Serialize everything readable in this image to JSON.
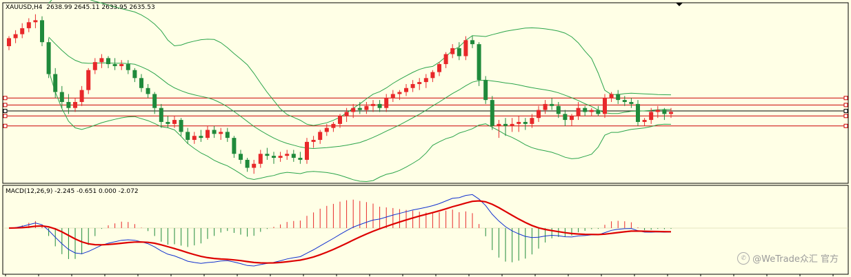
{
  "chart_data": [
    {
      "type": "candlestick",
      "symbol_title": "XAUUSD,H4",
      "ohlc_readout": "2638.99 2645.11 2633.95 2635.53",
      "header_text": "XAUUSD,H4  2638.99 2645.11 2633.95 2635.53",
      "bullish_color": "#e8282a",
      "bearish_color": "#1f8a3b",
      "candles": [
        [
          2652,
          2662,
          2648,
          2660
        ],
        [
          2660,
          2668,
          2655,
          2664
        ],
        [
          2664,
          2675,
          2660,
          2670
        ],
        [
          2670,
          2680,
          2666,
          2676
        ],
        [
          2676,
          2684,
          2670,
          2678
        ],
        [
          2678,
          2682,
          2652,
          2656
        ],
        [
          2656,
          2660,
          2620,
          2624
        ],
        [
          2624,
          2630,
          2600,
          2606
        ],
        [
          2606,
          2612,
          2590,
          2596
        ],
        [
          2596,
          2604,
          2584,
          2590
        ],
        [
          2590,
          2600,
          2586,
          2596
        ],
        [
          2596,
          2612,
          2592,
          2608
        ],
        [
          2608,
          2630,
          2604,
          2628
        ],
        [
          2628,
          2640,
          2624,
          2636
        ],
        [
          2636,
          2644,
          2630,
          2640
        ],
        [
          2640,
          2642,
          2630,
          2634
        ],
        [
          2634,
          2640,
          2628,
          2632
        ],
        [
          2632,
          2638,
          2628,
          2634
        ],
        [
          2634,
          2638,
          2624,
          2628
        ],
        [
          2628,
          2630,
          2616,
          2620
        ],
        [
          2620,
          2624,
          2606,
          2610
        ],
        [
          2610,
          2614,
          2600,
          2604
        ],
        [
          2604,
          2606,
          2584,
          2590
        ],
        [
          2590,
          2594,
          2570,
          2576
        ],
        [
          2576,
          2582,
          2570,
          2574
        ],
        [
          2574,
          2582,
          2570,
          2578
        ],
        [
          2578,
          2580,
          2562,
          2566
        ],
        [
          2566,
          2570,
          2554,
          2558
        ],
        [
          2558,
          2566,
          2554,
          2562
        ],
        [
          2562,
          2568,
          2556,
          2560
        ],
        [
          2560,
          2572,
          2558,
          2568
        ],
        [
          2568,
          2572,
          2560,
          2564
        ],
        [
          2564,
          2570,
          2558,
          2566
        ],
        [
          2566,
          2570,
          2556,
          2560
        ],
        [
          2560,
          2562,
          2540,
          2544
        ],
        [
          2544,
          2548,
          2534,
          2538
        ],
        [
          2538,
          2540,
          2526,
          2530
        ],
        [
          2530,
          2538,
          2524,
          2534
        ],
        [
          2534,
          2548,
          2530,
          2544
        ],
        [
          2544,
          2550,
          2538,
          2542
        ],
        [
          2542,
          2546,
          2534,
          2540
        ],
        [
          2540,
          2546,
          2536,
          2542
        ],
        [
          2542,
          2548,
          2538,
          2544
        ],
        [
          2544,
          2548,
          2536,
          2540
        ],
        [
          2540,
          2546,
          2534,
          2538
        ],
        [
          2538,
          2560,
          2534,
          2556
        ],
        [
          2556,
          2562,
          2550,
          2558
        ],
        [
          2558,
          2568,
          2554,
          2566
        ],
        [
          2566,
          2574,
          2562,
          2570
        ],
        [
          2570,
          2576,
          2566,
          2574
        ],
        [
          2574,
          2584,
          2570,
          2582
        ],
        [
          2582,
          2590,
          2576,
          2586
        ],
        [
          2586,
          2594,
          2580,
          2590
        ],
        [
          2590,
          2596,
          2584,
          2588
        ],
        [
          2588,
          2596,
          2584,
          2592
        ],
        [
          2592,
          2598,
          2586,
          2594
        ],
        [
          2594,
          2598,
          2586,
          2590
        ],
        [
          2590,
          2604,
          2586,
          2600
        ],
        [
          2600,
          2608,
          2596,
          2604
        ],
        [
          2604,
          2608,
          2598,
          2606
        ],
        [
          2606,
          2614,
          2602,
          2610
        ],
        [
          2610,
          2618,
          2606,
          2614
        ],
        [
          2614,
          2620,
          2608,
          2616
        ],
        [
          2616,
          2624,
          2610,
          2620
        ],
        [
          2620,
          2628,
          2616,
          2626
        ],
        [
          2626,
          2636,
          2622,
          2634
        ],
        [
          2634,
          2646,
          2630,
          2644
        ],
        [
          2644,
          2654,
          2640,
          2650
        ],
        [
          2650,
          2656,
          2638,
          2642
        ],
        [
          2642,
          2662,
          2638,
          2658
        ],
        [
          2658,
          2662,
          2650,
          2654
        ],
        [
          2654,
          2656,
          2612,
          2618
        ],
        [
          2618,
          2622,
          2594,
          2598
        ],
        [
          2598,
          2602,
          2568,
          2572
        ],
        [
          2572,
          2578,
          2560,
          2574
        ],
        [
          2574,
          2580,
          2562,
          2572
        ],
        [
          2572,
          2580,
          2566,
          2574
        ],
        [
          2574,
          2582,
          2566,
          2576
        ],
        [
          2576,
          2580,
          2568,
          2574
        ],
        [
          2574,
          2584,
          2570,
          2580
        ],
        [
          2580,
          2592,
          2576,
          2588
        ],
        [
          2588,
          2598,
          2584,
          2594
        ],
        [
          2594,
          2600,
          2588,
          2592
        ],
        [
          2592,
          2596,
          2580,
          2584
        ],
        [
          2584,
          2588,
          2572,
          2578
        ],
        [
          2578,
          2584,
          2572,
          2582
        ],
        [
          2582,
          2596,
          2578,
          2590
        ],
        [
          2590,
          2592,
          2582,
          2586
        ],
        [
          2586,
          2590,
          2582,
          2588
        ],
        [
          2588,
          2592,
          2582,
          2584
        ],
        [
          2584,
          2604,
          2580,
          2600
        ],
        [
          2600,
          2606,
          2596,
          2604
        ],
        [
          2604,
          2608,
          2594,
          2598
        ],
        [
          2598,
          2602,
          2592,
          2596
        ],
        [
          2596,
          2600,
          2590,
          2594
        ],
        [
          2594,
          2598,
          2572,
          2576
        ],
        [
          2576,
          2580,
          2572,
          2578
        ],
        [
          2578,
          2590,
          2574,
          2586
        ],
        [
          2586,
          2592,
          2580,
          2588
        ],
        [
          2588,
          2590,
          2578,
          2584
        ],
        [
          2584,
          2590,
          2580,
          2586
        ]
      ],
      "bollinger": {
        "period": 20,
        "deviations": 2
      },
      "horizontal_levels": [
        {
          "price": 2600,
          "color": "#cc0000"
        },
        {
          "price": 2593,
          "color": "#cc0000"
        },
        {
          "price": 2587,
          "color": "#000000"
        },
        {
          "price": 2582,
          "color": "#cc0000"
        },
        {
          "price": 2572,
          "color": "#cc0000"
        }
      ],
      "price_range": [
        2520,
        2690
      ]
    },
    {
      "type": "macd",
      "title": "MACD(12,26,9) -2.245 -0.651 0.000 -2.072",
      "fast": 12,
      "slow": 26,
      "signal": 9,
      "readout": [
        -2.245,
        -0.651,
        0.0,
        -2.072
      ],
      "histogram_color": "#1f8a3b",
      "histogram_positive_color": "#e8282a",
      "macd_line_color": "#1030d0",
      "signal_line_color": "#dd0000"
    }
  ],
  "watermark": {
    "icon": "wechat-icon",
    "text": "@WeTrade众汇 官方"
  }
}
